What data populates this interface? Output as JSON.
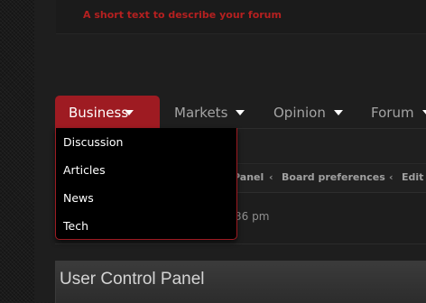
{
  "header": {
    "tagline": "A short text to describe your forum"
  },
  "nav": {
    "items": [
      {
        "label": "Business"
      },
      {
        "label": "Markets"
      },
      {
        "label": "Opinion"
      },
      {
        "label": "Forum"
      }
    ]
  },
  "dropdown": {
    "items": [
      {
        "label": "Discussion"
      },
      {
        "label": "Articles"
      },
      {
        "label": "News"
      },
      {
        "label": "Tech"
      }
    ]
  },
  "breadcrumbs": {
    "items": [
      "Panel",
      "Board preferences",
      "Edit"
    ],
    "separator": "‹"
  },
  "time_row": {
    "text": "36 pm"
  },
  "ucp": {
    "title": "User Control Panel"
  },
  "colors": {
    "accent": "#9e1b22",
    "tagline": "#b52020"
  }
}
